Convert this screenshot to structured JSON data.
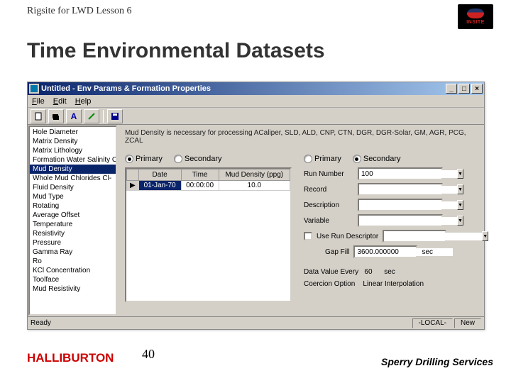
{
  "slide": {
    "header": "Rigsite for LWD Lesson 6",
    "title": "Time Environmental Datasets",
    "page_number": "40",
    "halliburton": "HALLIBURTON",
    "sperry": "Sperry Drilling Services",
    "insite": "INSITE"
  },
  "window": {
    "title": "Untitled - Env Params & Formation Properties",
    "min": "_",
    "max": "□",
    "close": "×"
  },
  "menu": {
    "file": "File",
    "edit": "Edit",
    "help": "Help"
  },
  "toolbar": {
    "new": "🗋",
    "open": "📂",
    "blueA": "A",
    "wand": "✎",
    "save": "💾"
  },
  "sidebar": {
    "items": [
      "Hole Diameter",
      "Matrix Density",
      "Matrix Lithology",
      "Formation Water Salinity Cl-",
      "Mud Density",
      "Whole Mud Chlorides Cl-",
      "Fluid Density",
      "Mud Type",
      "Rotating",
      "Average Offset",
      "Temperature",
      "Resistivity",
      "Pressure",
      "Gamma Ray",
      "Ro",
      "KCl Concentration",
      "Toolface",
      "Mud Resistivity"
    ],
    "selected_index": 4
  },
  "main": {
    "info": "Mud Density is necessary for processing ACaliper, SLD, ALD, CNP, CTN, DGR, DGR-Solar, GM, AGR, PCG, ZCAL",
    "left_radio": {
      "primary": "Primary",
      "secondary": "Secondary"
    },
    "right_radio": {
      "primary": "Primary",
      "secondary": "Secondary"
    },
    "table": {
      "headers": {
        "date": "Date",
        "time": "Time",
        "density": "Mud Density (ppg)"
      },
      "row": {
        "date": "01-Jan-70",
        "time": "00:00:00",
        "density": "10.0"
      }
    },
    "form": {
      "run_number_label": "Run Number",
      "run_number": "100",
      "record_label": "Record",
      "record": "",
      "description_label": "Description",
      "description": "",
      "variable_label": "Variable",
      "variable": "",
      "use_run_descriptor": "Use Run Descriptor",
      "gap_fill_label": "Gap Fill",
      "gap_fill": "3600.000000",
      "gap_fill_unit": "sec",
      "data_value_every_label": "Data Value Every",
      "data_value_every": "60",
      "data_value_unit": "sec",
      "coercion_label": "Coercion Option",
      "coercion_value": "Linear Interpolation"
    }
  },
  "status": {
    "ready": "Ready",
    "local": "-LOCAL-",
    "new": "New"
  }
}
